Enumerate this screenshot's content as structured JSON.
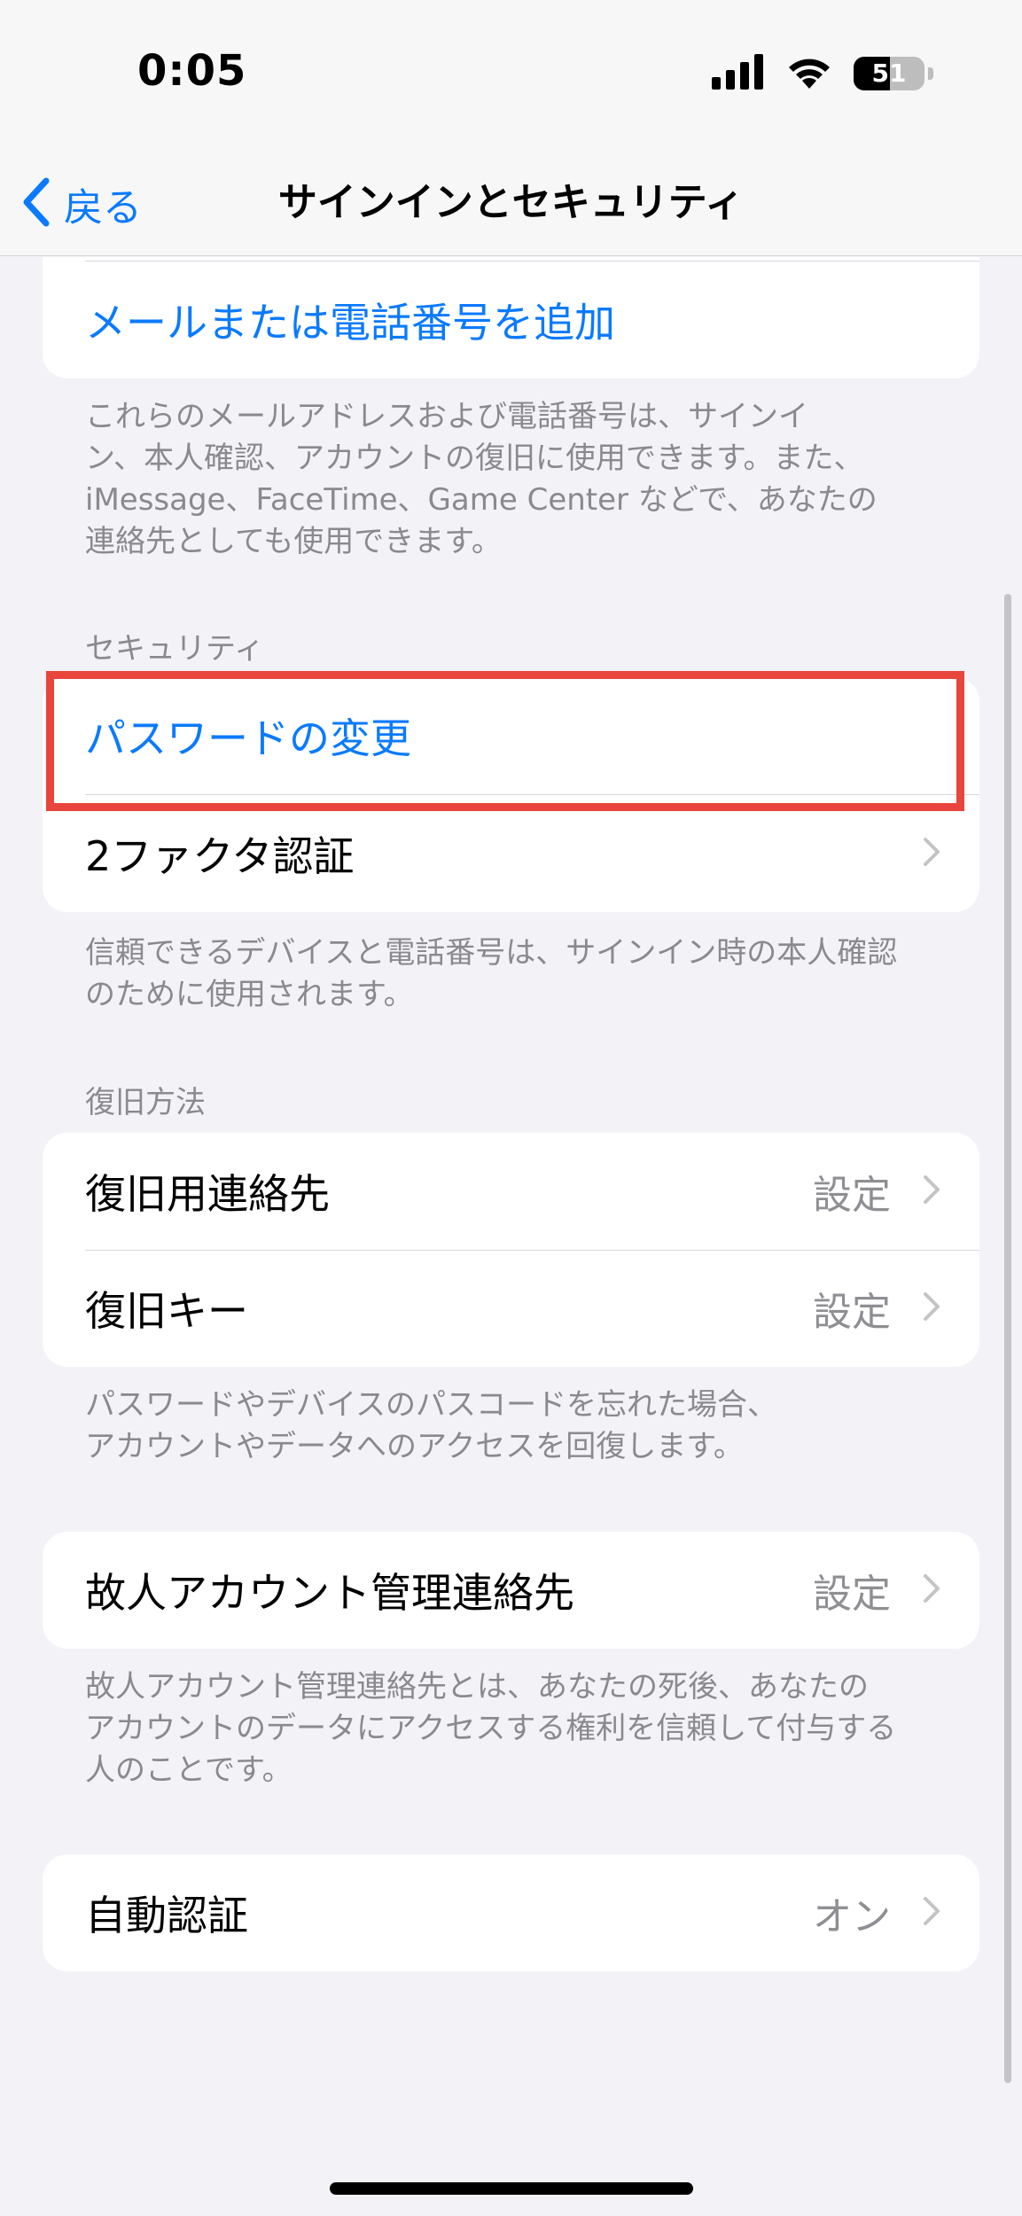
{
  "status_bar": {
    "time": "0:05",
    "battery_level": "51",
    "battery_fraction": 0.51,
    "icons": [
      "signal-icon",
      "wifi-icon",
      "battery-icon"
    ]
  },
  "nav": {
    "back_label": "戻る",
    "title": "サインインとセキュリティ"
  },
  "contact_card": {
    "add_label": "メールまたは電話番号を追加",
    "footnote_lines": [
      "これらのメールアドレスおよび電話番号は、サインイ",
      "ン、本人確認、アカウントの復旧に使用できます。また、",
      "iMessage、FaceTime、Game Center などで、あなたの",
      "連絡先としても使用できます。"
    ]
  },
  "security": {
    "header": "セキュリティ",
    "change_password": "パスワードの変更",
    "two_factor": "2ファクタ認証",
    "footnote_lines": [
      "信頼できるデバイスと電話番号は、サインイン時の本人確認",
      "のために使用されます。"
    ]
  },
  "recovery": {
    "header": "復旧方法",
    "items": [
      {
        "label": "復旧用連絡先",
        "value": "設定"
      },
      {
        "label": "復旧キー",
        "value": "設定"
      }
    ],
    "footnote_lines": [
      "パスワードやデバイスのパスコードを忘れた場合、",
      "アカウントやデータへのアクセスを回復します。"
    ]
  },
  "legacy": {
    "label": "故人アカウント管理連絡先",
    "value": "設定",
    "footnote_lines": [
      "故人アカウント管理連絡先とは、あなたの死後、あなたの",
      "アカウントのデータにアクセスする権利を信頼して付与する",
      "人のことです。"
    ]
  },
  "auto_verify": {
    "label": "自動認証",
    "value": "オン"
  },
  "colors": {
    "accent": "#0a7aff",
    "highlight": "#e8453c",
    "background": "#f2f2f7",
    "secondary_text": "#8a8a8e"
  }
}
